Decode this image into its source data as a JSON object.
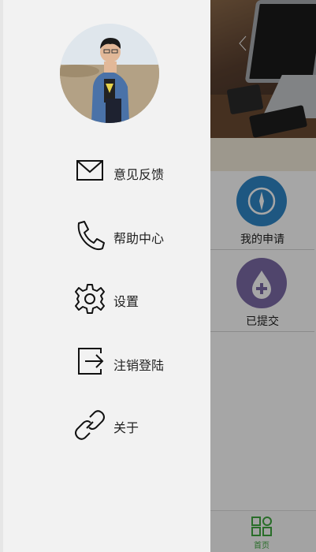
{
  "drawer": {
    "menu": [
      {
        "label": "意见反馈",
        "icon": "envelope-icon"
      },
      {
        "label": "帮助中心",
        "icon": "phone-icon"
      },
      {
        "label": "设置",
        "icon": "gear-icon"
      },
      {
        "label": "注销登陆",
        "icon": "logout-icon"
      },
      {
        "label": "关于",
        "icon": "link-icon"
      }
    ]
  },
  "background": {
    "tiles": [
      {
        "label": "我的申请",
        "icon": "compass-icon",
        "color": "#2f86c6"
      },
      {
        "label": "已提交",
        "icon": "drop-plus-icon",
        "color": "#7c6aa6"
      }
    ],
    "tabbar": {
      "home_label": "首页",
      "home_color": "#3fa83f"
    }
  },
  "colors": {
    "drawer_bg": "#f2f2f2",
    "overlay": "rgba(0,0,0,0.35)"
  }
}
